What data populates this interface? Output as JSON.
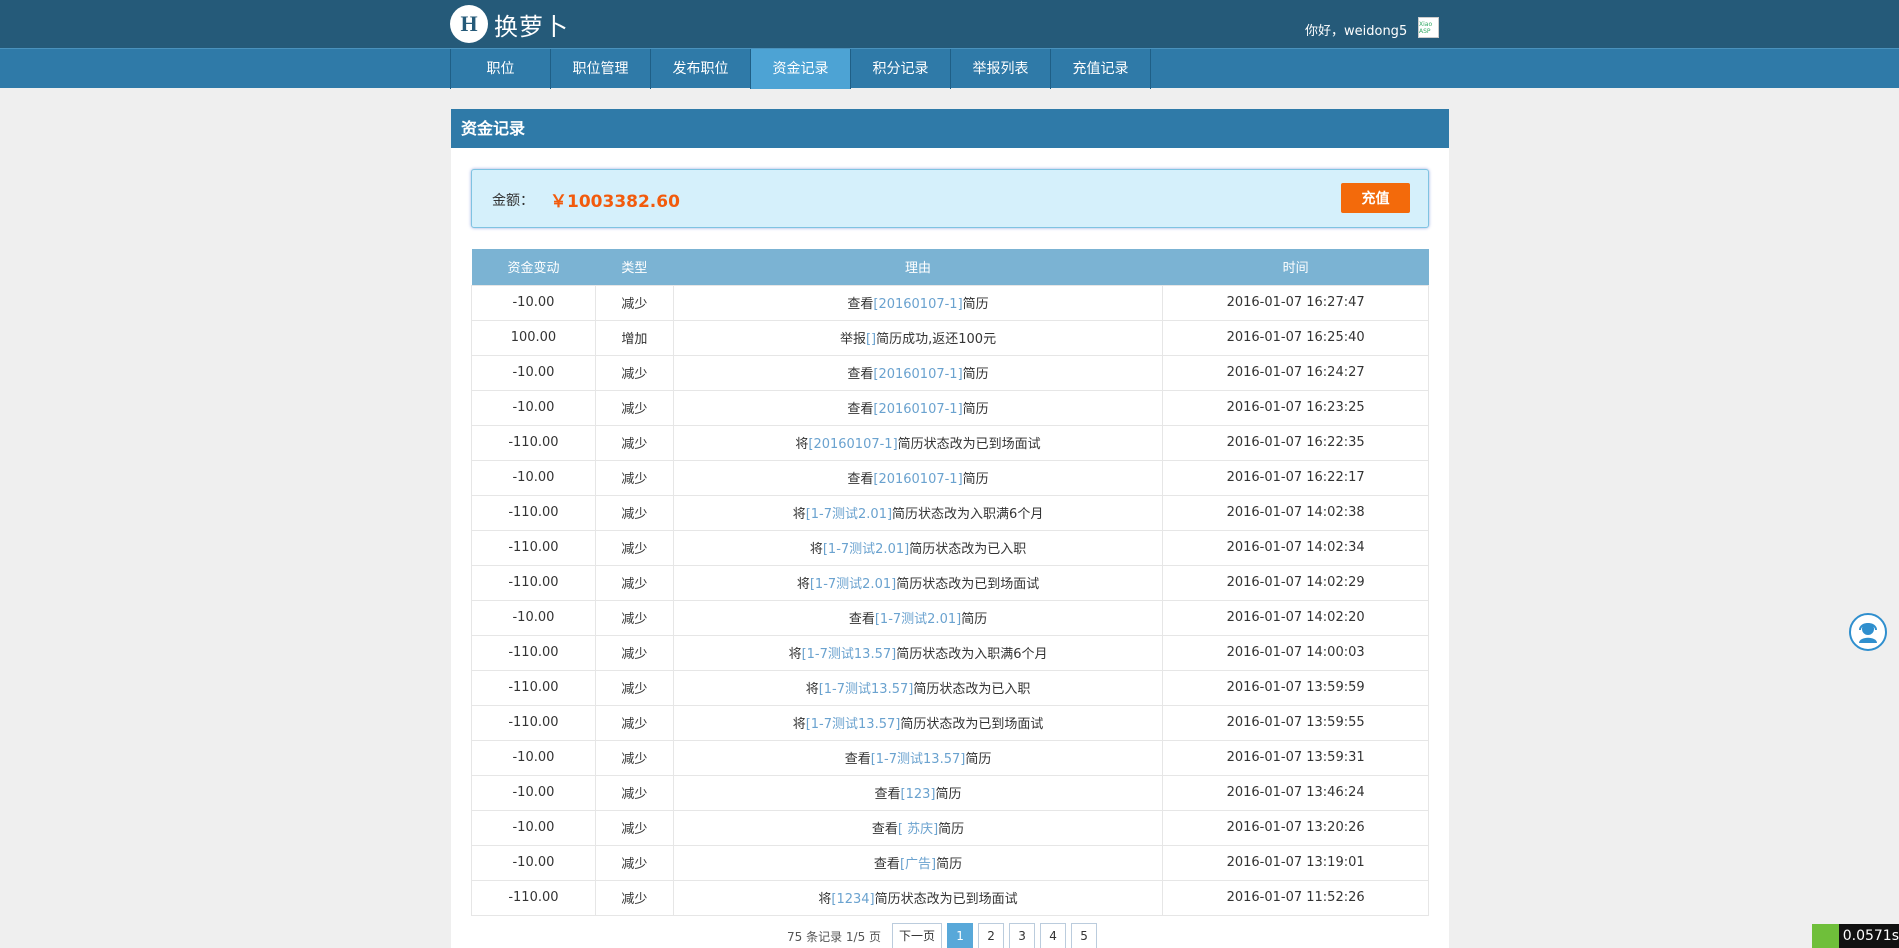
{
  "brand": {
    "logo_mark": "H",
    "logo_text": "换萝卜"
  },
  "header": {
    "greeting": "你好，weidong5",
    "avatar_text": "Xiao ASP"
  },
  "nav": {
    "items": [
      {
        "label": "职位"
      },
      {
        "label": "职位管理"
      },
      {
        "label": "发布职位"
      },
      {
        "label": "资金记录",
        "active": true
      },
      {
        "label": "积分记录"
      },
      {
        "label": "举报列表"
      },
      {
        "label": "充值记录"
      }
    ]
  },
  "panel": {
    "title": "资金记录"
  },
  "balance": {
    "label": "金额：",
    "value": "￥1003382.60",
    "recharge_label": "充值"
  },
  "table": {
    "headers": [
      "资金变动",
      "类型",
      "理由",
      "时间"
    ],
    "rows": [
      {
        "amount": "-10.00",
        "type": "减少",
        "prefix": "查看",
        "link": "[20160107-1]",
        "suffix": "简历",
        "time": "2016-01-07 16:27:47"
      },
      {
        "amount": "100.00",
        "type": "增加",
        "prefix": "举报",
        "link": "[]",
        "suffix": "简历成功,返还100元",
        "time": "2016-01-07 16:25:40"
      },
      {
        "amount": "-10.00",
        "type": "减少",
        "prefix": "查看",
        "link": "[20160107-1]",
        "suffix": "简历",
        "time": "2016-01-07 16:24:27"
      },
      {
        "amount": "-10.00",
        "type": "减少",
        "prefix": "查看",
        "link": "[20160107-1]",
        "suffix": "简历",
        "time": "2016-01-07 16:23:25"
      },
      {
        "amount": "-110.00",
        "type": "减少",
        "prefix": "将",
        "link": "[20160107-1]",
        "suffix": "简历状态改为已到场面试",
        "time": "2016-01-07 16:22:35"
      },
      {
        "amount": "-10.00",
        "type": "减少",
        "prefix": "查看",
        "link": "[20160107-1]",
        "suffix": "简历",
        "time": "2016-01-07 16:22:17"
      },
      {
        "amount": "-110.00",
        "type": "减少",
        "prefix": "将",
        "link": "[1-7测试2.01]",
        "suffix": "简历状态改为入职满6个月",
        "time": "2016-01-07 14:02:38"
      },
      {
        "amount": "-110.00",
        "type": "减少",
        "prefix": "将",
        "link": "[1-7测试2.01]",
        "suffix": "简历状态改为已入职",
        "time": "2016-01-07 14:02:34"
      },
      {
        "amount": "-110.00",
        "type": "减少",
        "prefix": "将",
        "link": "[1-7测试2.01]",
        "suffix": "简历状态改为已到场面试",
        "time": "2016-01-07 14:02:29"
      },
      {
        "amount": "-10.00",
        "type": "减少",
        "prefix": "查看",
        "link": "[1-7测试2.01]",
        "suffix": "简历",
        "time": "2016-01-07 14:02:20"
      },
      {
        "amount": "-110.00",
        "type": "减少",
        "prefix": "将",
        "link": "[1-7测试13.57]",
        "suffix": "简历状态改为入职满6个月",
        "time": "2016-01-07 14:00:03"
      },
      {
        "amount": "-110.00",
        "type": "减少",
        "prefix": "将",
        "link": "[1-7测试13.57]",
        "suffix": "简历状态改为已入职",
        "time": "2016-01-07 13:59:59"
      },
      {
        "amount": "-110.00",
        "type": "减少",
        "prefix": "将",
        "link": "[1-7测试13.57]",
        "suffix": "简历状态改为已到场面试",
        "time": "2016-01-07 13:59:55"
      },
      {
        "amount": "-10.00",
        "type": "减少",
        "prefix": "查看",
        "link": "[1-7测试13.57]",
        "suffix": "简历",
        "time": "2016-01-07 13:59:31"
      },
      {
        "amount": "-10.00",
        "type": "减少",
        "prefix": "查看",
        "link": "[123]",
        "suffix": "简历",
        "time": "2016-01-07 13:46:24"
      },
      {
        "amount": "-10.00",
        "type": "减少",
        "prefix": "查看",
        "link": "[ 苏庆]",
        "suffix": "简历",
        "time": "2016-01-07 13:20:26"
      },
      {
        "amount": "-10.00",
        "type": "减少",
        "prefix": "查看",
        "link": "[广告]",
        "suffix": "简历",
        "time": "2016-01-07 13:19:01"
      },
      {
        "amount": "-110.00",
        "type": "减少",
        "prefix": "将",
        "link": "[1234]",
        "suffix": "简历状态改为已到场面试",
        "time": "2016-01-07 11:52:26"
      }
    ]
  },
  "pager": {
    "info": "75 条记录 1/5 页",
    "next_label": "下一页",
    "pages": [
      "1",
      "2",
      "3",
      "4",
      "5"
    ],
    "current": "1"
  },
  "badge": {
    "timer": "0.0571s"
  },
  "colors": {
    "topbar": "#255a79",
    "nav": "#2f7aa8",
    "nav_active": "#4da3d4",
    "accent": "#f36a0b",
    "link": "#6aa2cf"
  }
}
